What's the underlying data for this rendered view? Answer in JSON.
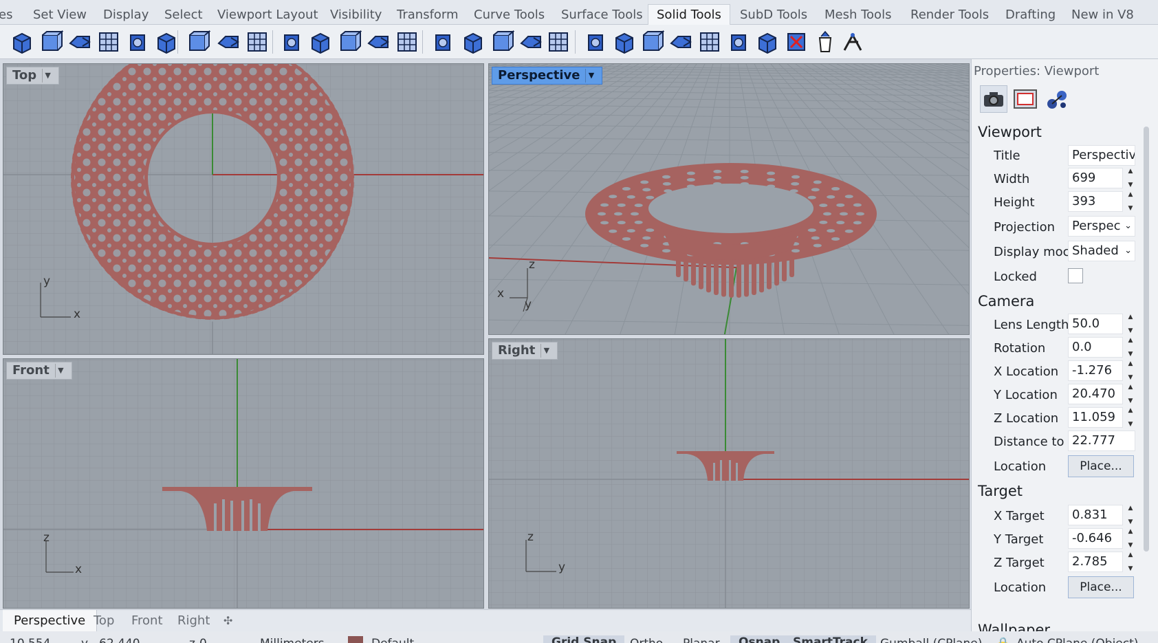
{
  "tabs": [
    {
      "label": "es"
    },
    {
      "label": "Set View"
    },
    {
      "label": "Display"
    },
    {
      "label": "Select"
    },
    {
      "label": "Viewport Layout"
    },
    {
      "label": "Visibility"
    },
    {
      "label": "Transform"
    },
    {
      "label": "Curve Tools"
    },
    {
      "label": "Surface Tools"
    },
    {
      "label": "Solid Tools"
    },
    {
      "label": "SubD Tools"
    },
    {
      "label": "Mesh Tools"
    },
    {
      "label": "Render Tools"
    },
    {
      "label": "Drafting"
    },
    {
      "label": "New in V8"
    }
  ],
  "toolbar_icons": [
    "box-icon",
    "sphere-icon",
    "cylinder-icon",
    "layers-stack-icon",
    "solid-cube-icon",
    "gears-icon",
    "extrude-box-icon",
    "cap-icon",
    "shell-icon",
    "fillet-edge-icon",
    "boolean-union-icon",
    "boolean-difference-icon",
    "boolean-split-icon",
    "boolean-intersect-icon",
    "move-face-icon",
    "extract-face-icon",
    "slab-icon",
    "wire-cut-icon",
    "grid-box-icon",
    "round-hole-icon",
    "array-hole-icon",
    "rotate-hole-icon",
    "move-hole-icon",
    "text-object-icon",
    "pattern-icon",
    "lattice-icon",
    "delete-hole-icon",
    "bucket-icon",
    "solid-points-icon"
  ],
  "viewports": {
    "top": {
      "label": "Top",
      "axis_x": "x",
      "axis_y": "y"
    },
    "perspective": {
      "label": "Perspective",
      "axis_x": "x",
      "axis_y": "y",
      "axis_z": "z"
    },
    "front": {
      "label": "Front",
      "axis_x": "x",
      "axis_z": "z"
    },
    "right": {
      "label": "Right",
      "axis_y": "y",
      "axis_z": "z"
    }
  },
  "viewport_tabs": [
    "Perspective",
    "Top",
    "Front",
    "Right"
  ],
  "viewport_tab_add": "✣",
  "status": {
    "x_coord": "10.554",
    "y_label": "y",
    "y_coord": "-62.440",
    "z_label": "z",
    "z_coord": "0",
    "units": "Millimeters",
    "layer": "Default",
    "grid_snap": "Grid Snap",
    "ortho": "Ortho",
    "planar": "Planar",
    "osnap": "Osnap",
    "smarttrack": "SmartTrack",
    "gumball": "Gumball (CPlane)",
    "auto_cplane": "Auto CPlane (Object)",
    "layer_color": "#8b5553"
  },
  "properties": {
    "title": "Properties: Viewport",
    "icons": [
      "camera-icon",
      "viewport-frame-icon",
      "render-spheres-icon"
    ],
    "viewport_section": "Viewport",
    "title_label": "Title",
    "title_value": "Perspective",
    "width_label": "Width",
    "width_value": "699",
    "height_label": "Height",
    "height_value": "393",
    "projection_label": "Projection",
    "projection_value": "Perspec",
    "display_mode_label": "Display moc",
    "display_mode_value": "Shaded",
    "locked_label": "Locked",
    "camera_section": "Camera",
    "lens_label": "Lens Length",
    "lens_value": "50.0",
    "rotation_label": "Rotation",
    "rotation_value": "0.0",
    "xloc_label": "X Location",
    "xloc_value": "-1.276",
    "yloc_label": "Y Location",
    "yloc_value": "20.470",
    "zloc_label": "Z Location",
    "zloc_value": "11.059",
    "dist_label": "Distance to",
    "dist_value": "22.777",
    "location_label": "Location",
    "place_button": "Place...",
    "target_section": "Target",
    "xtarget_label": "X Target",
    "xtarget_value": "0.831",
    "ytarget_label": "Y Target",
    "ytarget_value": "-0.646",
    "ztarget_label": "Z Target",
    "ztarget_value": "2.785",
    "target_location_label": "Location",
    "target_place_button": "Place...",
    "wallpaper_section": "Wallpaper"
  },
  "colors": {
    "model": "#a66360",
    "x_axis": "#a33a38",
    "y_axis": "#3a8a34",
    "viewport_bg": "#9aa1a9",
    "active_viewport_label": "#5f9ce8"
  }
}
